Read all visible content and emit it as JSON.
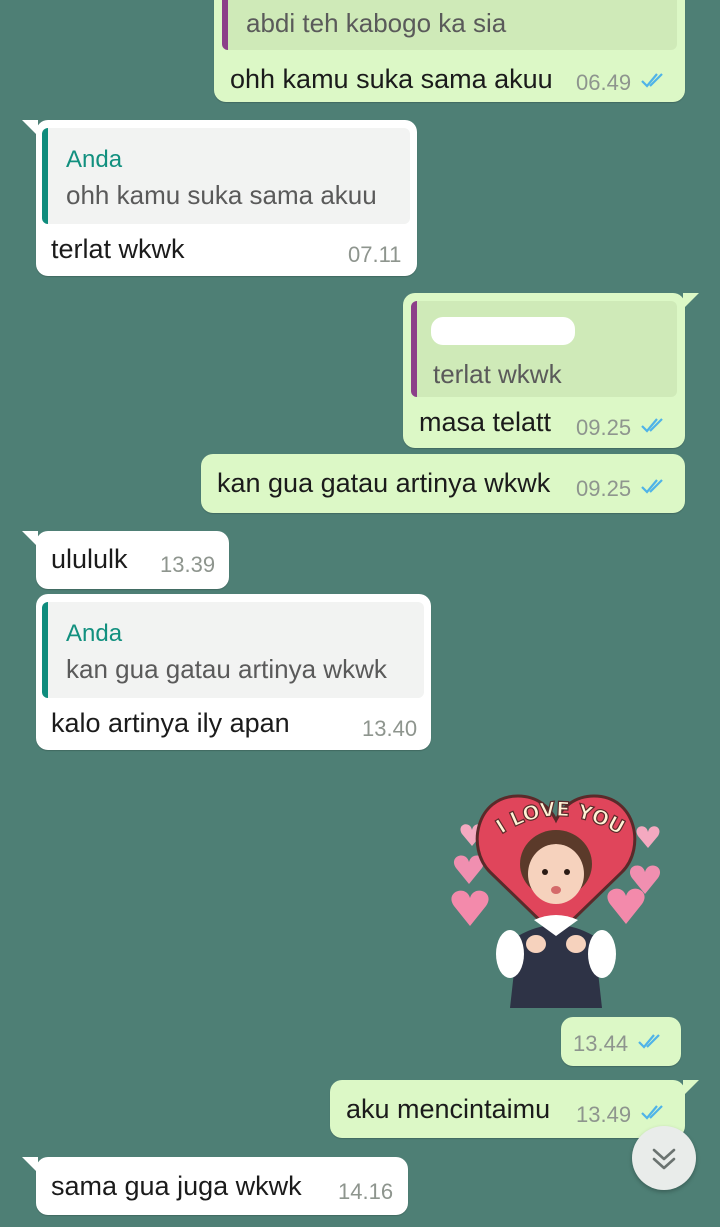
{
  "colors": {
    "background": "#4e7f75",
    "outgoing_bubble": "#dcf8c6",
    "incoming_bubble": "#ffffff",
    "read_ticks": "#4fb3e8",
    "quote_name": "#12907f"
  },
  "messages": [
    {
      "quote_text": "abdi teh kabogo ka sia",
      "text": "ohh kamu suka sama akuu",
      "time": "06.49"
    },
    {
      "quote_name": "Anda",
      "quote_text": "ohh kamu suka sama akuu",
      "text": "terlat wkwk",
      "time": "07.11"
    },
    {
      "quote_text": "terlat wkwk",
      "text": "masa telatt",
      "time": "09.25"
    },
    {
      "text": "kan gua gatau artinya wkwk",
      "time": "09.25"
    },
    {
      "text": "ulululk",
      "time": "13.39"
    },
    {
      "quote_name": "Anda",
      "quote_text": "kan gua gatau artinya wkwk",
      "text": "kalo artinya ily apan",
      "time": "13.40"
    },
    {
      "sticker_text": "I LOVE YOU",
      "time": "13.44"
    },
    {
      "text": "aku mencintaimu",
      "time": "13.49"
    },
    {
      "text": "sama gua juga wkwk",
      "time": "14.16"
    }
  ],
  "icons": {
    "read_receipt": "double-check-icon",
    "scroll_down": "chevron-double-down-icon"
  }
}
